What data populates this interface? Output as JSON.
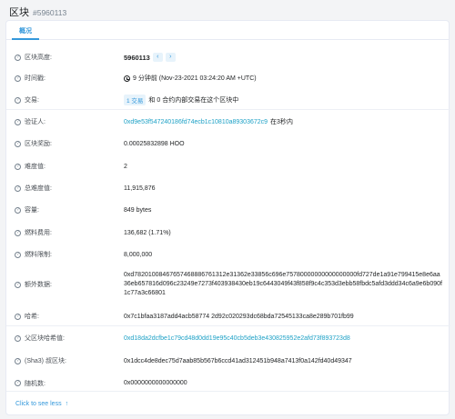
{
  "header": {
    "title": "区块",
    "block_number": "#5960113"
  },
  "tabs": [
    {
      "label": "概况"
    }
  ],
  "rows": {
    "height": {
      "label": "区块高度:",
      "value": "5960113",
      "prev": "‹",
      "next": "›"
    },
    "timestamp": {
      "label": "时间戳:",
      "value": "9 分钟前 (Nov-23-2021 03:24:20 AM +UTC)"
    },
    "transactions": {
      "label": "交易:",
      "tx_badge": "1 交易",
      "suffix": "和 0 合约内部交易在这个区块中"
    },
    "validator": {
      "label": "验证人:",
      "address": "0xd9e53f547240186fd74ecb1c10810a89303672c9",
      "suffix": "在3秒内"
    },
    "reward": {
      "label": "区块奖励:",
      "value": "0.00025832898 HOO"
    },
    "difficulty": {
      "label": "难度值:",
      "value": "2"
    },
    "total_difficulty": {
      "label": "总难度值:",
      "value": "11,915,876"
    },
    "size": {
      "label": "容量:",
      "value": "849 bytes"
    },
    "gas_used": {
      "label": "燃料费用:",
      "value": "136,682 (1.71%)"
    },
    "gas_limit": {
      "label": "燃料限制:",
      "value": "8,000,000"
    },
    "extra_data": {
      "label": "额外数据:",
      "value": "0xd78201008467657468886761312e31362e33856c696e75780000000000000000fd727de1a91e799415e8e6aa36eb657816d096c23249e7273f403938430eb19c6443049f43f858f9c4c353d3ebb58fbdc5afd3ddd34c6a9e6b090f1c77a3c66801"
    },
    "hash": {
      "label": "哈希:",
      "value": "0x7c1bfaa3187add4acb58774 2d92c020293dc68bda72545133ca8e289b701fb99"
    },
    "parent_hash": {
      "label": "父区块哈希值:",
      "value": "0xd18da2dcfbe1c79cd48d0dd19e95c40cb5deb3e430825952e2afd73f893723d8"
    },
    "sha3_uncles": {
      "label": "(Sha3) 叔区块:",
      "value": "0x1dcc4de8dec75d7aab85b567b6ccd41ad312451b948a7413f0a142fd40d49347"
    },
    "nonce": {
      "label": "随机数:",
      "value": "0x0000000000000000"
    }
  },
  "see_less": {
    "label": "Click to see less",
    "arrow": "↑"
  },
  "icons": {
    "help": "question-circle-icon",
    "clock": "clock-icon"
  },
  "colors": {
    "accent": "#3498db",
    "link": "#1da1c6",
    "background": "#f3f4f6"
  }
}
